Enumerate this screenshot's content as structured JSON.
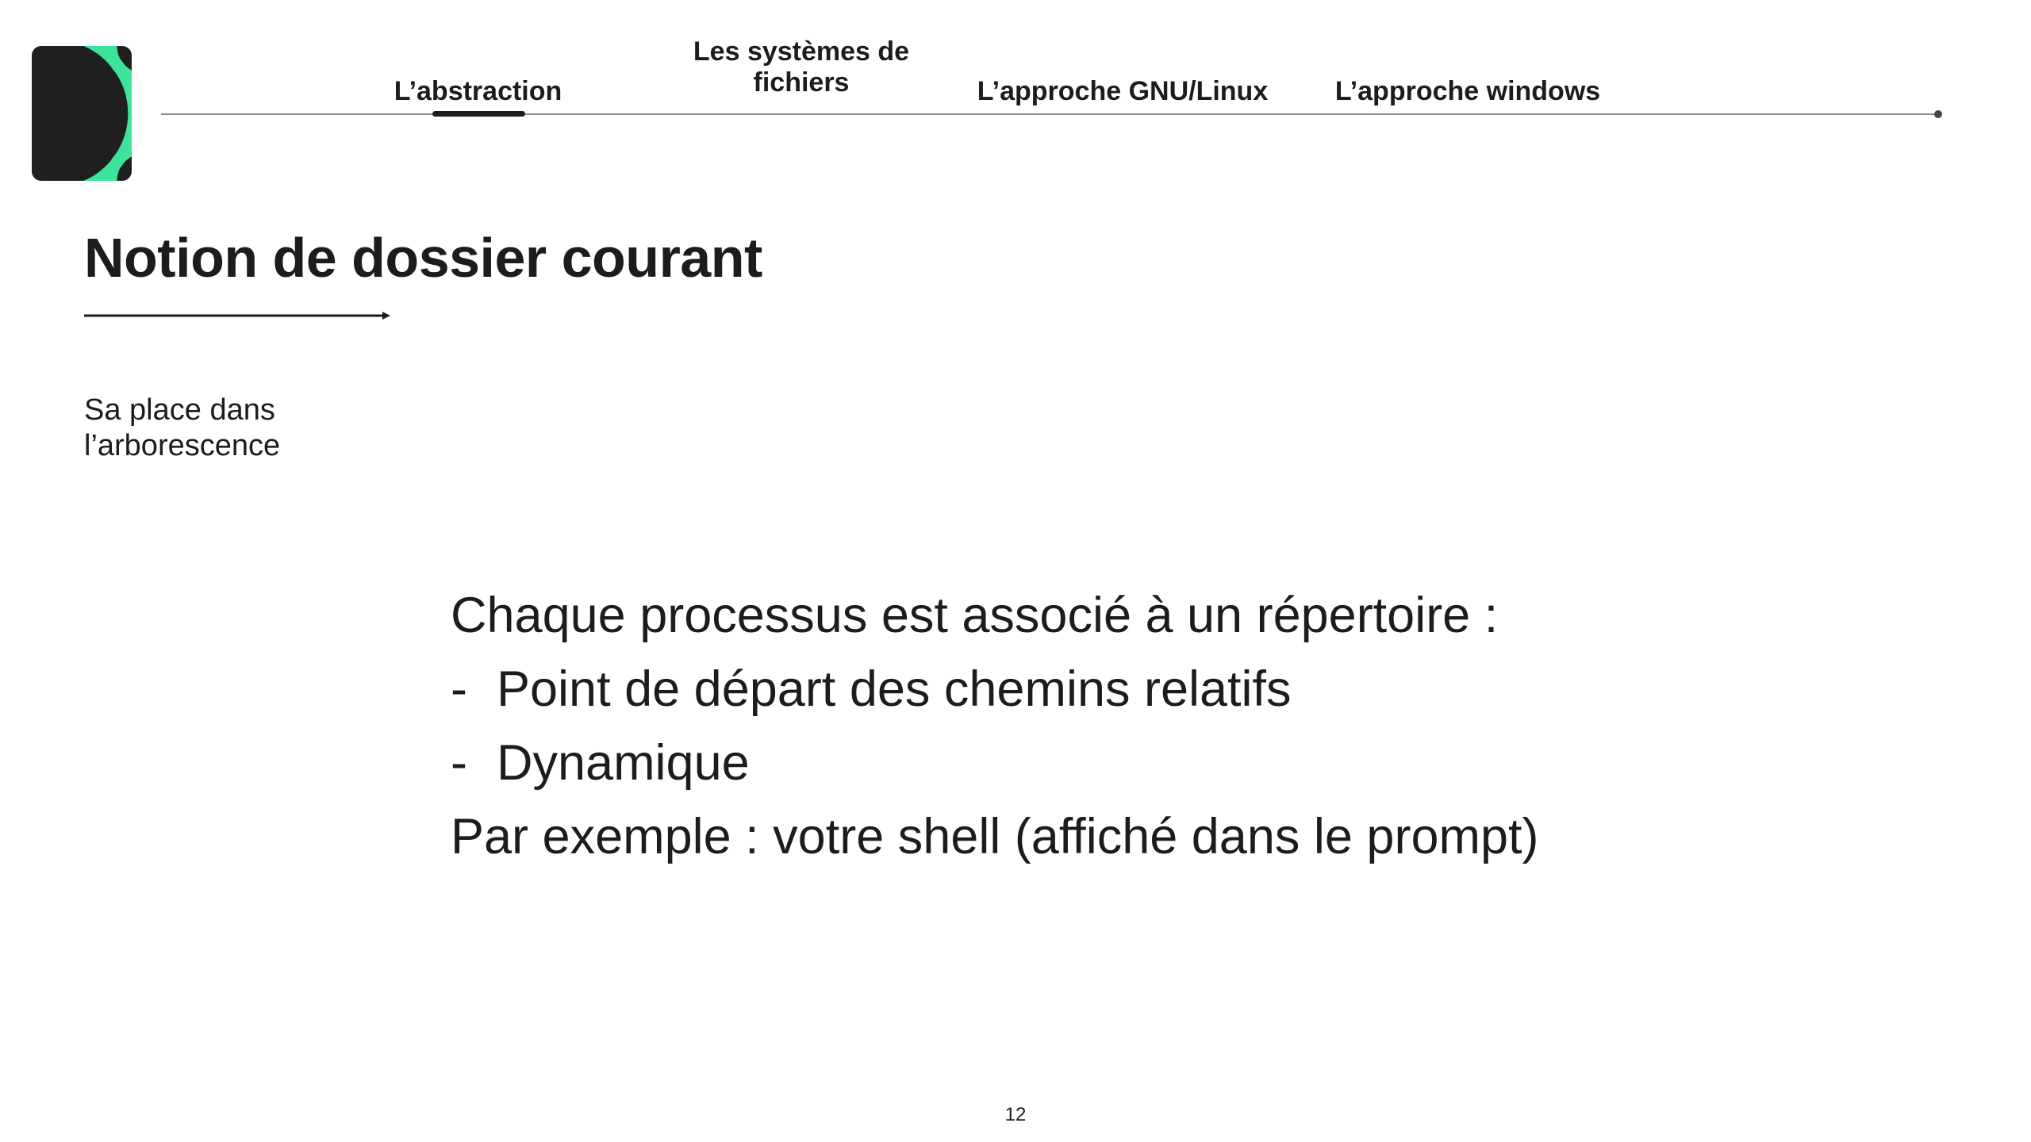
{
  "brand": {
    "accent_color": "#3ee39a",
    "logo_background": "#1f1f1f",
    "logo_icon": "brand-logo-icon"
  },
  "nav": {
    "tabs": [
      {
        "label": "L’abstraction",
        "active": true
      },
      {
        "label": "Les systèmes de fichiers",
        "active": false
      },
      {
        "label": "L’approche GNU/Linux",
        "active": false
      },
      {
        "label": "L’approche windows",
        "active": false
      }
    ]
  },
  "slide": {
    "title": "Notion de dossier courant",
    "subtitle": "Sa place dans l’arborescence",
    "intro": "Chaque processus est associé à un répertoire :",
    "bullets": [
      "Point de départ des chemins relatifs",
      "Dynamique"
    ],
    "bullet_marker": "-",
    "example": "Par exemple : votre shell (affiché dans le prompt)"
  },
  "footer": {
    "page_number": "12"
  }
}
